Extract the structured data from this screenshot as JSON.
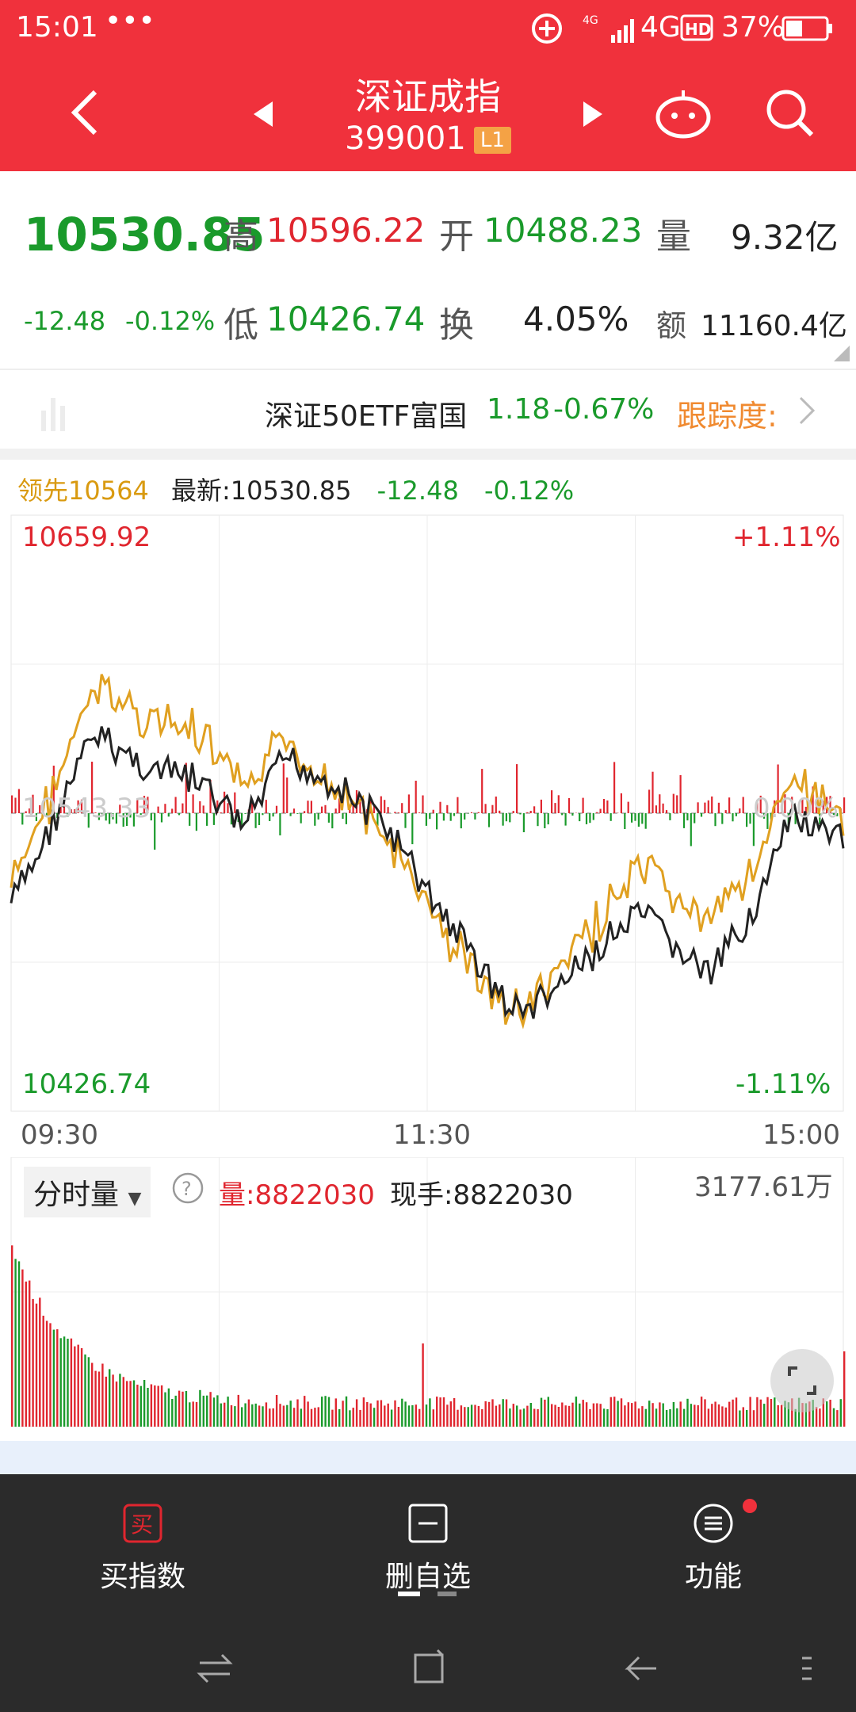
{
  "status": {
    "time": "15:01",
    "dots": "•••",
    "network": "4G",
    "battery": "37%",
    "sig_small": "4G"
  },
  "header": {
    "title": "深证成指",
    "code": "399001",
    "level": "L1"
  },
  "quote": {
    "price": "10530.85",
    "change": "-12.48",
    "change_pct": "-0.12%",
    "high_label": "高",
    "high": "10596.22",
    "low_label": "低",
    "low": "10426.74",
    "open_label": "开",
    "open": "10488.23",
    "turnover_label": "换",
    "turnover": "4.05%",
    "volume_label": "量",
    "volume": "9.32亿",
    "amount_label": "额",
    "amount": "11160.4亿"
  },
  "etf": {
    "name": "深证50ETF富国",
    "price": "1.18",
    "change": "-0.67%",
    "track_label": "跟踪度:"
  },
  "chart_legend": {
    "lead": "领先10564",
    "latest": "最新:10530.85",
    "change": "-12.48",
    "change_pct": "-0.12%"
  },
  "chart_axis": {
    "max": "10659.92",
    "min": "10426.74",
    "max_pct": "+1.11%",
    "min_pct": "-1.11%",
    "mid": "10543.33",
    "mid_pct": "0.00%",
    "times": [
      "09:30",
      "11:30",
      "15:00"
    ]
  },
  "volume_panel": {
    "selector": "分时量",
    "volume": "量:8822030",
    "current": "现手:8822030",
    "max": "3177.61万"
  },
  "banner_text": "",
  "bottom_nav": [
    {
      "label": "买指数",
      "icon": "buy-icon"
    },
    {
      "label": "删自选",
      "icon": "delete-icon"
    },
    {
      "label": "功能",
      "icon": "menu-icon"
    }
  ],
  "colors": {
    "red": "#e0262f",
    "green": "#1a9a2b",
    "lead_line": "#e0a020",
    "price_line": "#222222",
    "topbar": "#f0313c"
  }
}
